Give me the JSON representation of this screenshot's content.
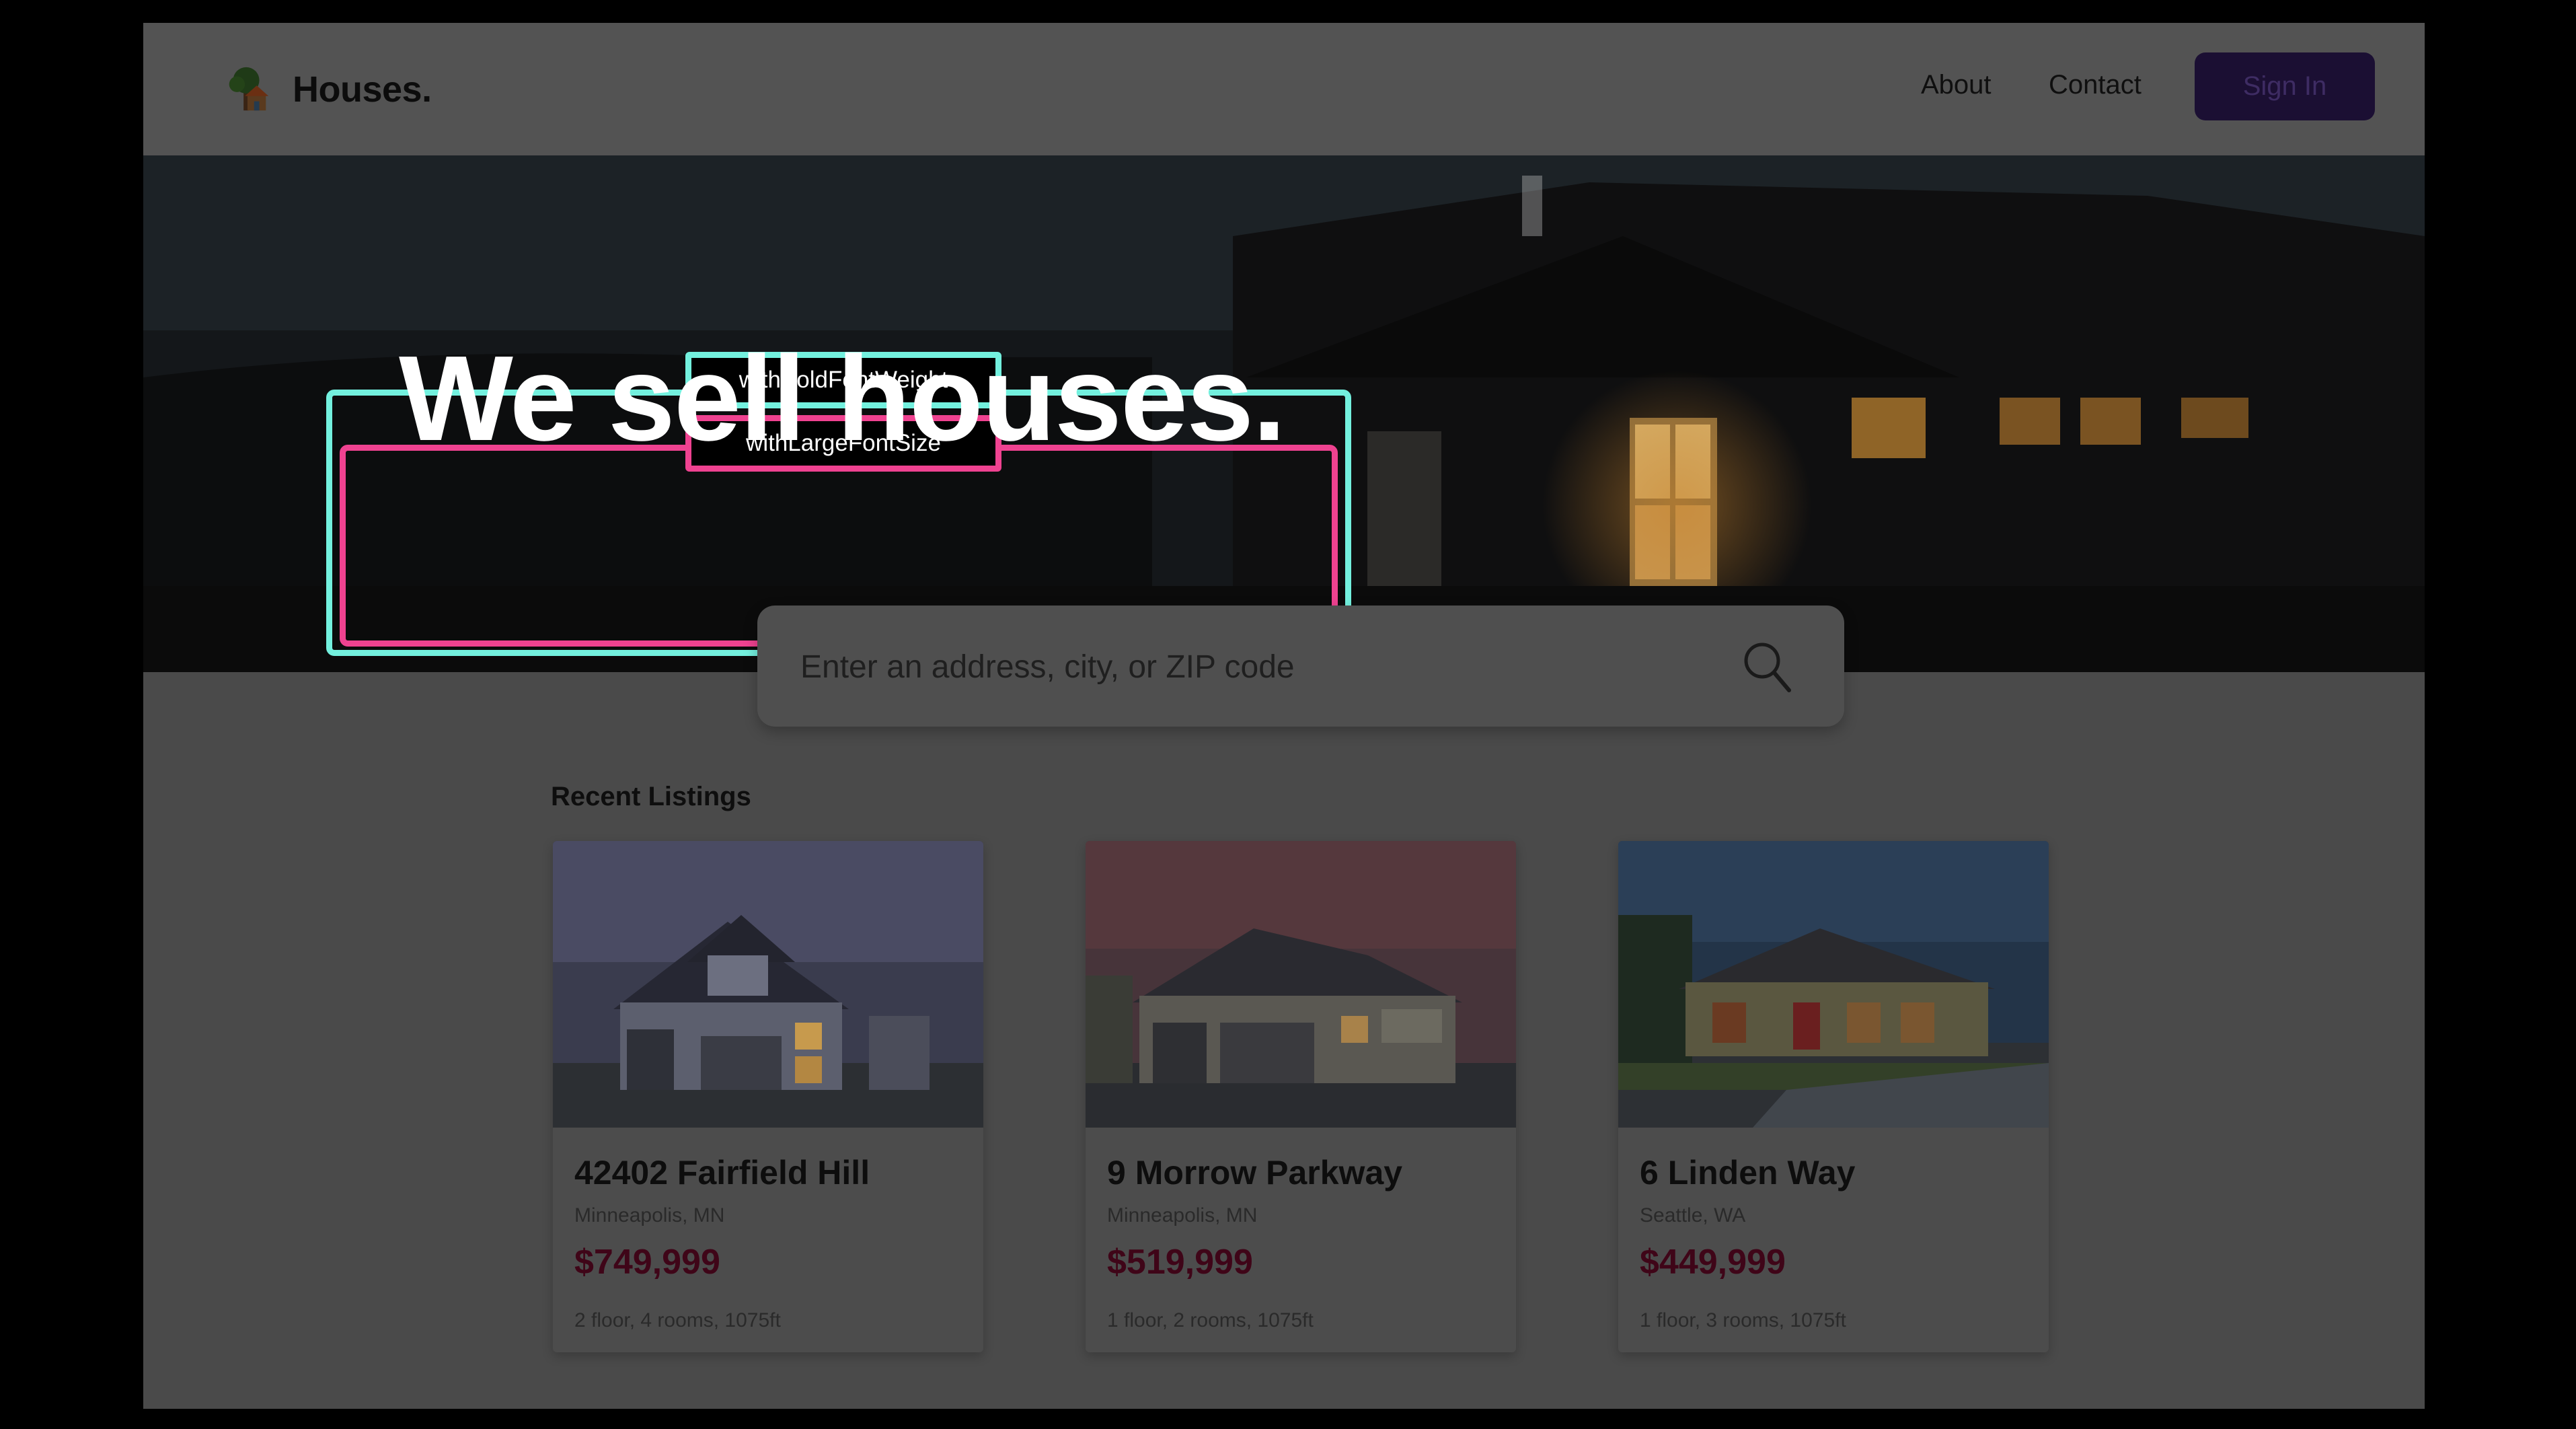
{
  "header": {
    "brand": "Houses.",
    "logo_icon": "tree-house-icon",
    "nav": [
      {
        "label": "About"
      },
      {
        "label": "Contact"
      }
    ],
    "signin_label": "Sign In"
  },
  "hero": {
    "title": "We sell houses.",
    "overlay_labels": {
      "bold": "withBoldFontWeight",
      "large": "withLargeFontSize"
    },
    "overlay_colors": {
      "bold": "#73f0de",
      "large": "#ef4290"
    }
  },
  "search": {
    "placeholder": "Enter an address, city, or ZIP code",
    "icon": "search-icon"
  },
  "listings": {
    "title": "Recent Listings",
    "items": [
      {
        "title": "42402 Fairfield Hill",
        "city": "Minneapolis, MN",
        "price": "$749,999",
        "meta": "2 floor, 4 rooms, 1075ft"
      },
      {
        "title": "9 Morrow Parkway",
        "city": "Minneapolis, MN",
        "price": "$519,999",
        "meta": "1 floor, 2 rooms, 1075ft"
      },
      {
        "title": "6 Linden Way",
        "city": "Seattle, WA",
        "price": "$449,999",
        "meta": "1 floor, 3 rooms, 1075ft"
      }
    ]
  },
  "colors": {
    "accent": "#1b0f33",
    "price": "#3f0518"
  }
}
